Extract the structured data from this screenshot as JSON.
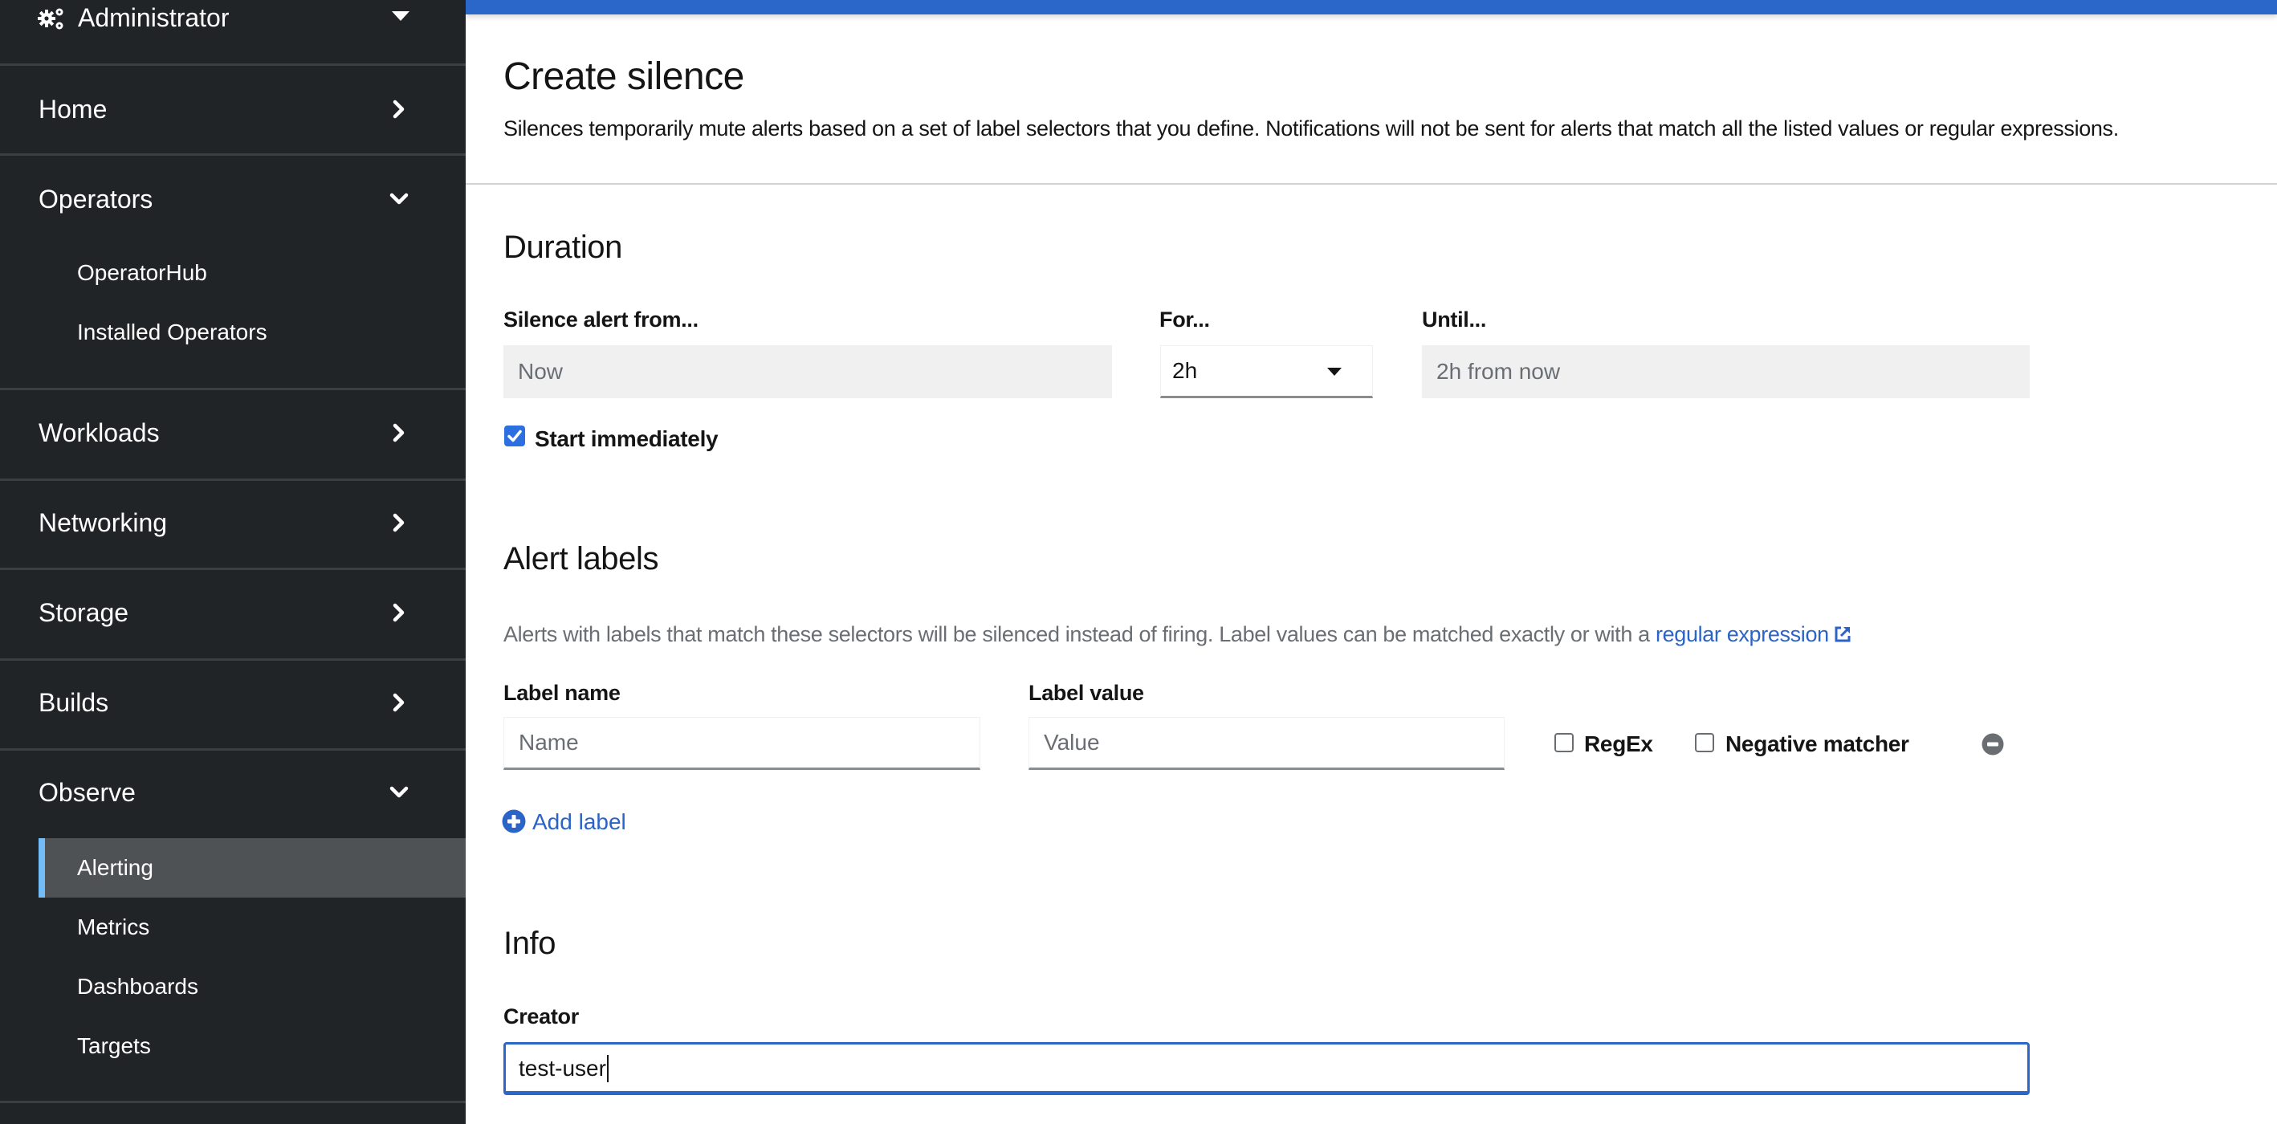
{
  "sidebar": {
    "perspective": {
      "label": "Administrator",
      "icon": "gears-icon"
    },
    "sections": [
      {
        "label": "Home",
        "expanded": false
      },
      {
        "label": "Operators",
        "expanded": true,
        "items": [
          {
            "label": "OperatorHub"
          },
          {
            "label": "Installed Operators"
          }
        ]
      },
      {
        "label": "Workloads",
        "expanded": false
      },
      {
        "label": "Networking",
        "expanded": false
      },
      {
        "label": "Storage",
        "expanded": false
      },
      {
        "label": "Builds",
        "expanded": false
      },
      {
        "label": "Observe",
        "expanded": true,
        "items": [
          {
            "label": "Alerting",
            "active": true
          },
          {
            "label": "Metrics"
          },
          {
            "label": "Dashboards"
          },
          {
            "label": "Targets"
          }
        ]
      }
    ]
  },
  "page": {
    "title": "Create silence",
    "description": "Silences temporarily mute alerts based on a set of label selectors that you define. Notifications will not be sent for alerts that match all the listed values or regular expressions."
  },
  "duration": {
    "heading": "Duration",
    "from_label": "Silence alert from...",
    "from_value": "Now",
    "for_label": "For...",
    "for_value": "2h",
    "until_label": "Until...",
    "until_value": "2h from now",
    "start_immediately_label": "Start immediately",
    "start_immediately_checked": true
  },
  "alert_labels": {
    "heading": "Alert labels",
    "helper_text": "Alerts with labels that match these selectors will be silenced instead of firing. Label values can be matched exactly or with a ",
    "helper_link": "regular expression",
    "label_name_label": "Label name",
    "label_name_placeholder": "Name",
    "label_value_label": "Label value",
    "label_value_placeholder": "Value",
    "regex_label": "RegEx",
    "regex_checked": false,
    "negative_label": "Negative matcher",
    "negative_checked": false,
    "add_label": "Add label"
  },
  "info": {
    "heading": "Info",
    "creator_label": "Creator",
    "creator_value": "test-user"
  },
  "colors": {
    "sidebar_bg": "#212427",
    "active_item_bg": "#4f5255",
    "active_accent": "#73bcf7",
    "banner": "#2b66c9",
    "link": "#2b63c6",
    "checkbox_checked": "#2b6fe0"
  }
}
